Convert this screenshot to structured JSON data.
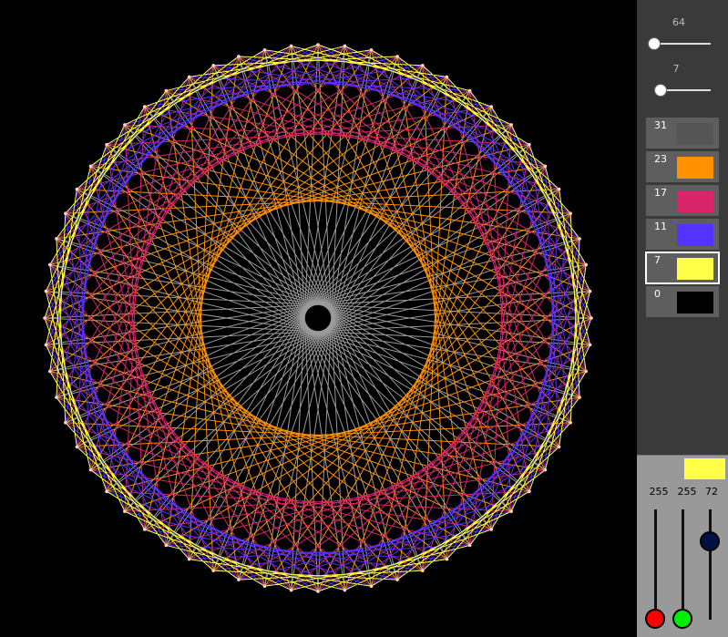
{
  "canvas": {
    "background": "#000000",
    "points": 64,
    "ring_pins": "#f4d7c4"
  },
  "controls": {
    "points_slider": {
      "label": "64",
      "value": 64
    },
    "step_slider": {
      "label": "7",
      "value": 7
    }
  },
  "layers": [
    {
      "label": "31",
      "color": "#555555",
      "selected": false
    },
    {
      "label": "23",
      "color": "#ff9000",
      "selected": false
    },
    {
      "label": "17",
      "color": "#d82468",
      "selected": false
    },
    {
      "label": "11",
      "color": "#5533ff",
      "selected": false
    },
    {
      "label": "7",
      "color": "#ffff48",
      "selected": true
    },
    {
      "label": "0",
      "color": "#000000",
      "selected": false
    }
  ],
  "mixer": {
    "preview_color": "#ffff48",
    "red": {
      "value": "255",
      "knob_color": "#ff0000"
    },
    "green": {
      "value": "255",
      "knob_color": "#00ee00"
    },
    "blue": {
      "value": "72",
      "knob_color": "#001144"
    }
  }
}
